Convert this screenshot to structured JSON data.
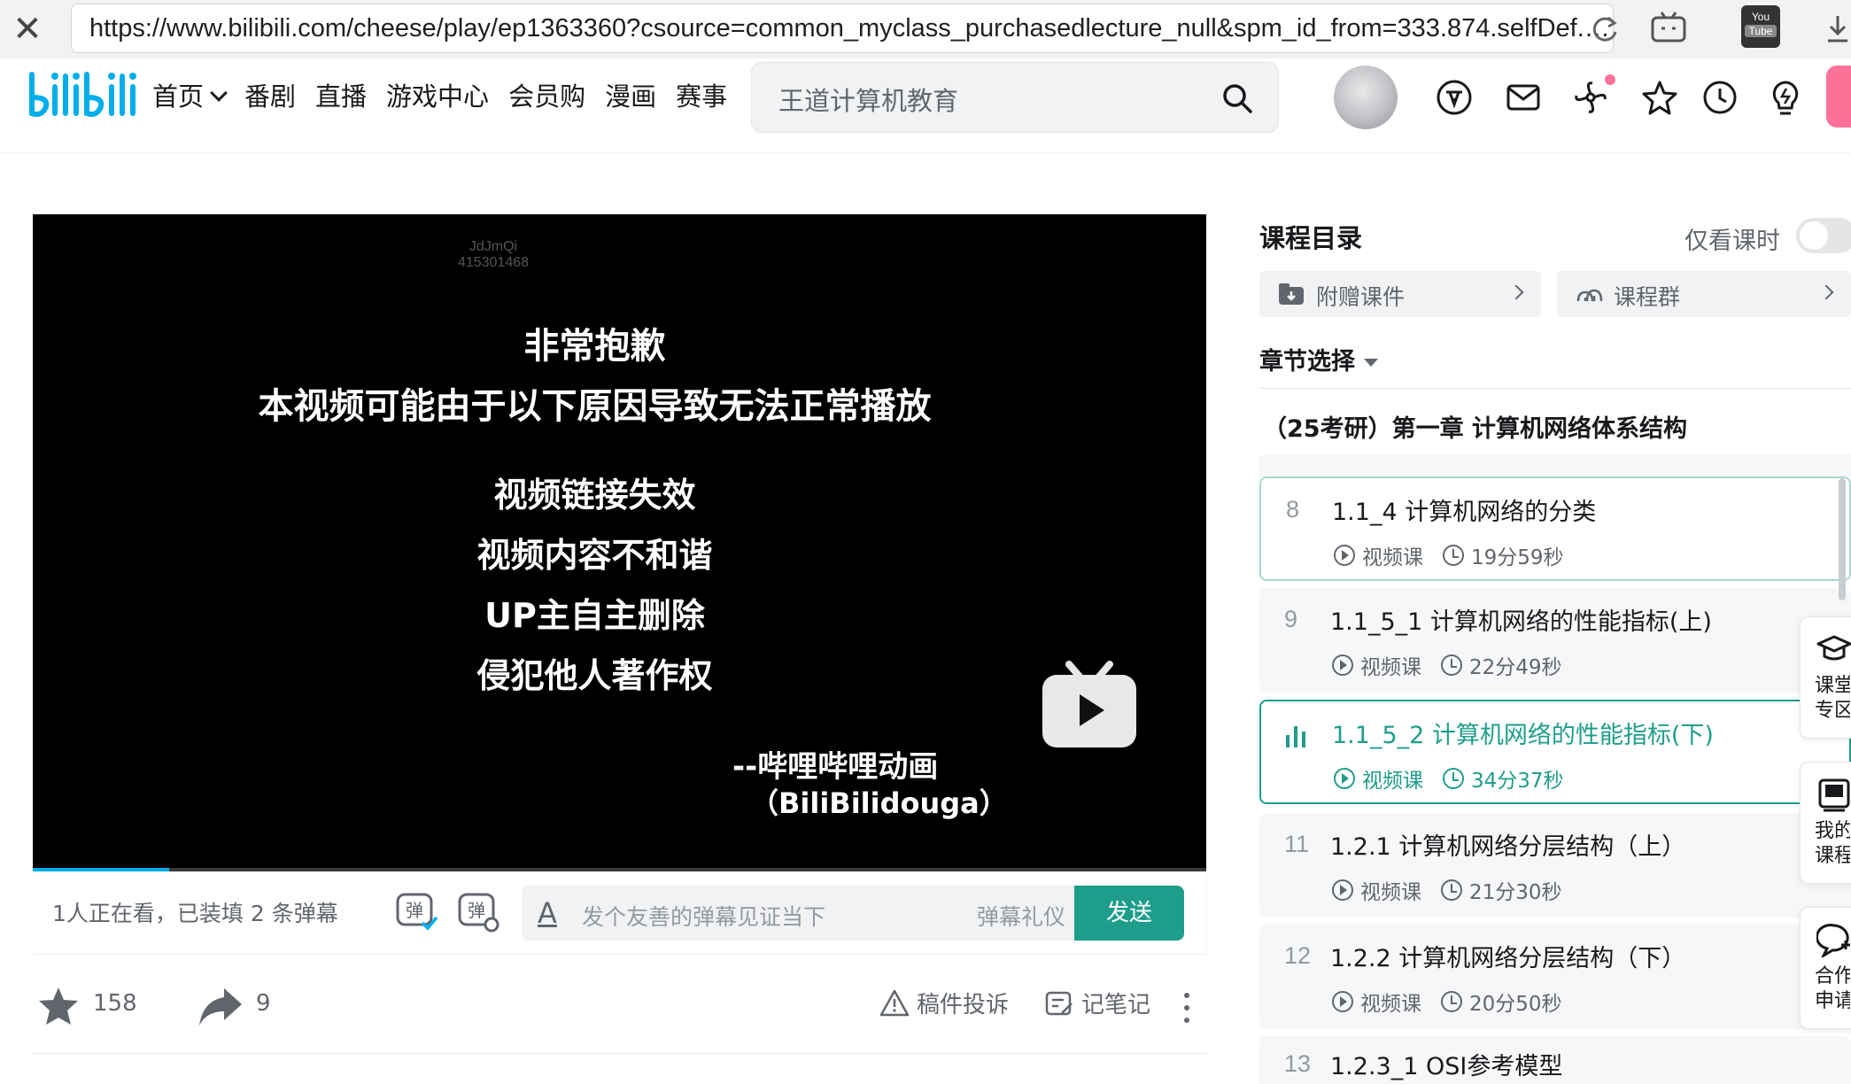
{
  "browser": {
    "url": "https://www.bilibili.com/cheese/play/ep1363360?csource=common_myclass_purchasedlecture_null&spm_id_from=333.874.selfDef.…",
    "ext_label_top": "You",
    "ext_label_bottom": "Tube"
  },
  "header": {
    "nav": [
      "首页",
      "番剧",
      "直播",
      "游戏中心",
      "会员购",
      "漫画",
      "赛事"
    ],
    "search_placeholder": "王道计算机教育"
  },
  "player": {
    "watermark_line1": "JdJmQi",
    "watermark_line2": "415301468",
    "error_title": "非常抱歉",
    "error_subtitle": "本视频可能由于以下原因导致无法正常播放",
    "reasons": [
      "视频链接失效",
      "视频内容不和谐",
      "UP主自主删除",
      "侵犯他人著作权"
    ],
    "signature_cn": "--哔哩哔哩动画",
    "signature_en": "（BiliBilidouga）",
    "progress_fraction": 0.116
  },
  "danmaku": {
    "status": "1人正在看，已装填 2 条弹幕",
    "input_icon": "A",
    "placeholder": "发个友善的弹幕见证当下",
    "etiquette": "弹幕礼仪 ›",
    "send": "发送"
  },
  "toolbar": {
    "favorites": "158",
    "shares": "9",
    "report": "稿件投诉",
    "notes": "记笔记"
  },
  "sidebar": {
    "title": "课程目录",
    "only_lessons": "仅看课时",
    "pill_courseware": "附赠课件",
    "pill_group": "课程群",
    "chapter_select": "章节选择",
    "chapter_name": "（25考研）第一章 计算机网络体系结构",
    "lessons": [
      {
        "num": "8",
        "title": "1.1_4 计算机网络的分类",
        "type": "视频课",
        "duration": "19分59秒"
      },
      {
        "num": "9",
        "title": "1.1_5_1 计算机网络的性能指标(上)",
        "type": "视频课",
        "duration": "22分49秒"
      },
      {
        "num": "",
        "title": "1.1_5_2 计算机网络的性能指标(下)",
        "type": "视频课",
        "duration": "34分37秒"
      },
      {
        "num": "11",
        "title": "1.2.1 计算机网络分层结构（上）",
        "type": "视频课",
        "duration": "21分30秒"
      },
      {
        "num": "12",
        "title": "1.2.2 计算机网络分层结构（下）",
        "type": "视频课",
        "duration": "20分50秒"
      },
      {
        "num": "13",
        "title": "1.2.3_1 OSI参考模型",
        "type": "",
        "duration": ""
      }
    ],
    "float_cards": [
      {
        "line1": "课堂",
        "line2": "专区"
      },
      {
        "line1": "我的",
        "line2": "课程"
      },
      {
        "line1": "合作",
        "line2": "申请"
      }
    ]
  },
  "colors": {
    "accent_teal": "#1e9e8a",
    "bili_blue": "#00aeec",
    "bili_pink": "#fb7299"
  }
}
